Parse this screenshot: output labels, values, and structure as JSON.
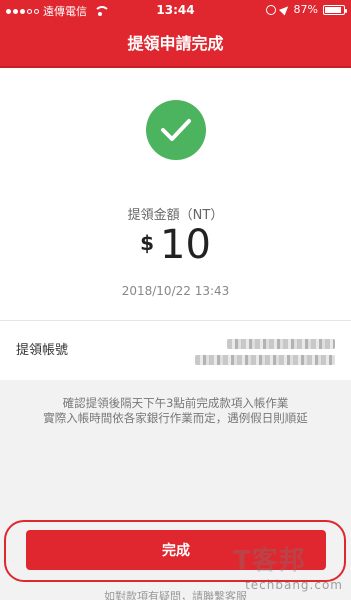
{
  "status_bar": {
    "carrier": "遠傳電信",
    "time": "13:44",
    "battery": "87%",
    "battery_level": 0.87
  },
  "header": {
    "title": "提領申請完成"
  },
  "summary": {
    "amount_label": "提領金額（NT）",
    "currency_symbol": "$",
    "amount": "10",
    "datetime": "2018/10/22 13:43"
  },
  "account": {
    "label": "提領帳號"
  },
  "note": {
    "line1": "確認提領後隔天下午3點前完成款項入帳作業",
    "line2": "實際入帳時間依各家銀行作業而定，遇例假日則順延"
  },
  "actions": {
    "done_label": "完成"
  },
  "footer": {
    "partial_text": "如對款項有疑問，請聯繫客服"
  },
  "watermark": {
    "brand": "T客邦",
    "site": "techbang.com"
  },
  "colors": {
    "brand_red": "#e0262e",
    "success_green": "#4cb35e"
  }
}
